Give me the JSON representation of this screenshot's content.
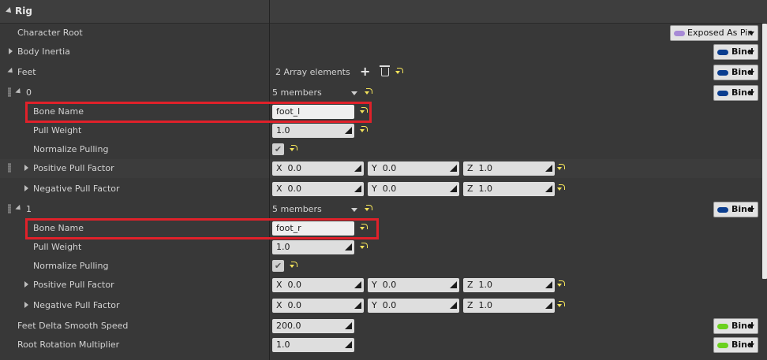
{
  "section": {
    "title": "Rig"
  },
  "rows": {
    "character_root": {
      "label": "Character Root",
      "pin": "Exposed As Pin",
      "pin_color": "#a78ad6"
    },
    "body_inertia": {
      "label": "Body Inertia",
      "bind": "Bind"
    },
    "feet": {
      "label": "Feet",
      "array_text": "2 Array elements",
      "bind": "Bind"
    },
    "foot0": {
      "index": "0",
      "members": "5 members",
      "bind": "Bind",
      "bone_name_label": "Bone Name",
      "bone_name": "foot_l",
      "pull_weight_label": "Pull Weight",
      "pull_weight": "1.0",
      "normalize_label": "Normalize Pulling",
      "normalize_checked": "✔",
      "pos_label": "Positive Pull Factor",
      "pos": {
        "x": "0.0",
        "y": "0.0",
        "z": "1.0"
      },
      "neg_label": "Negative Pull Factor",
      "neg": {
        "x": "0.0",
        "y": "0.0",
        "z": "1.0"
      }
    },
    "foot1": {
      "index": "1",
      "members": "5 members",
      "bind": "Bind",
      "bone_name_label": "Bone Name",
      "bone_name": "foot_r",
      "pull_weight_label": "Pull Weight",
      "pull_weight": "1.0",
      "normalize_label": "Normalize Pulling",
      "normalize_checked": "✔",
      "pos_label": "Positive Pull Factor",
      "pos": {
        "x": "0.0",
        "y": "0.0",
        "z": "1.0"
      },
      "neg_label": "Negative Pull Factor",
      "neg": {
        "x": "0.0",
        "y": "0.0",
        "z": "1.0"
      }
    },
    "feet_delta": {
      "label": "Feet Delta Smooth Speed",
      "value": "200.0",
      "bind": "Bind"
    },
    "root_rotation": {
      "label": "Root Rotation Multiplier",
      "value": "1.0",
      "bind": "Bind"
    }
  },
  "axis_labels": {
    "x": "X",
    "y": "Y",
    "z": "Z"
  },
  "colors": {
    "bind_blue": "#0a3d8f",
    "bind_green": "#6bd11e",
    "reset_yellow": "#f2e25a",
    "highlight_red": "#e0212a"
  }
}
